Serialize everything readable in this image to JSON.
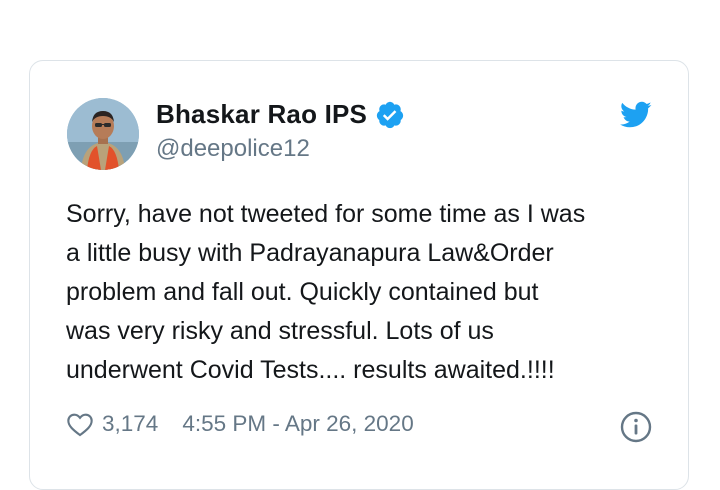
{
  "author": {
    "name": "Bhaskar Rao IPS",
    "handle": "@deepolice12"
  },
  "tweet": {
    "lines": [
      "Sorry, have not tweeted for some time as I was",
      "a little busy with Padrayanapura Law&Order",
      "problem and fall out. Quickly contained but",
      "was very risky and stressful. Lots of us",
      "underwent Covid Tests.... results awaited.!!!!"
    ]
  },
  "footer": {
    "likes": "3,174",
    "timestamp": "4:55 PM - Apr 26, 2020"
  },
  "colors": {
    "twitter_blue": "#1da1f2",
    "text": "#14171a",
    "muted": "#657786",
    "border": "#dde3e8"
  },
  "icons": {
    "verified": "verified-badge-icon",
    "brand": "twitter-bird-icon",
    "like": "heart-icon",
    "info": "info-icon"
  }
}
